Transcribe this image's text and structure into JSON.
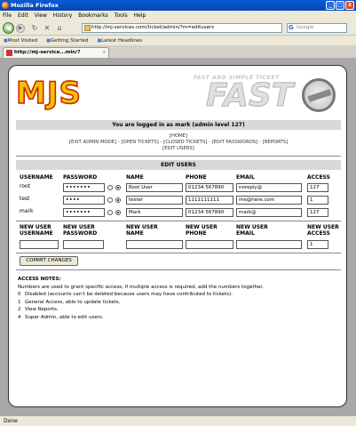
{
  "window": {
    "title": "Mozilla Firefox",
    "minimize": "_",
    "maximize": "□",
    "close": "x"
  },
  "menu": [
    "File",
    "Edit",
    "View",
    "History",
    "Bookmarks",
    "Tools",
    "Help"
  ],
  "nav": {
    "back": "◀",
    "forward": "▶",
    "reload": "↻",
    "stop": "✕",
    "home": "⌂",
    "url": "http://mj-services.com/ticket/admin/?m=editusers",
    "search_placeholder": "Google",
    "search_logo": "G"
  },
  "bookmarks": [
    "Most Visited",
    "Getting Started",
    "Latest Headlines"
  ],
  "tab": {
    "label": "http://mj-service...min/?m=editusers",
    "close": "x"
  },
  "brand": {
    "left_logo": "MJS",
    "right_subtitle": "FAST AND SIMPLE TICKET",
    "right_title": "FAST"
  },
  "logged_in": "You are logged in as mark (admin level 127)",
  "links": {
    "home": "[HOME]",
    "row2": "[EXIT ADMIN MODE] - [OPEN TICKETS] - [CLOSED TICKETS] - [EDIT PASSWORDS] - [REPORTS]",
    "row3": "[EDIT USERS]"
  },
  "edit_users": {
    "title": "EDIT USERS",
    "headers": [
      "USERNAME",
      "PASSWORD",
      "NAME",
      "PHONE",
      "EMAIL",
      "ACCESS"
    ],
    "users": [
      {
        "username": "root",
        "password": "•••••••",
        "name": "Root User",
        "phone": "01234 567890",
        "email": "noreply@",
        "access": "127"
      },
      {
        "username": "test",
        "password": "••••",
        "name": "tester",
        "phone": "1111111111",
        "email": "me@here.com",
        "access": "1"
      },
      {
        "username": "mark",
        "password": "•••••••",
        "name": "Mark",
        "phone": "01234 567890",
        "email": "mark@",
        "access": "127"
      }
    ],
    "new_headers": [
      [
        "NEW USER",
        "USERNAME"
      ],
      [
        "NEW USER",
        "PASSWORD"
      ],
      [
        "NEW USER",
        "NAME"
      ],
      [
        "NEW USER",
        "PHONE"
      ],
      [
        "NEW USER",
        "EMAIL"
      ],
      [
        "NEW USER",
        "ACCESS"
      ]
    ],
    "new_access_default": "1",
    "commit_label": "COMMIT CHANGES"
  },
  "access_notes": {
    "title": "ACCESS NOTES:",
    "intro": "Numbers are used to grant specific access, if multiple access is required, add the numbers together.",
    "items": [
      {
        "num": "0",
        "text": "Disabled (accounts can't be deleted because users may have contributed to tickets)."
      },
      {
        "num": "1",
        "text": "General Access, able to update tickets."
      },
      {
        "num": "2",
        "text": "View Reports."
      },
      {
        "num": "4",
        "text": "Super Admin, able to edit users."
      }
    ]
  },
  "status": "Done"
}
